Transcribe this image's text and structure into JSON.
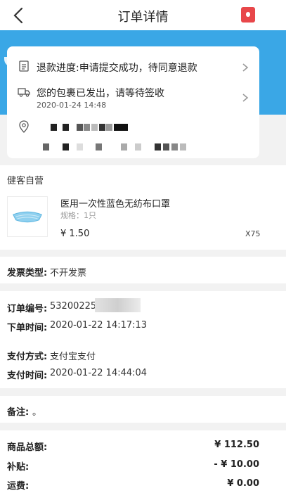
{
  "nav": {
    "title": "订单详情"
  },
  "status": {
    "refund_text": "退款进度:申请提交成功，待同意退款",
    "shipping_text": "您的包裹已发出，请等待签收",
    "shipping_time": "2020-01-24 14:48"
  },
  "shop": {
    "name": "健客自营"
  },
  "product": {
    "title": "医用一次性蓝色无纺布口罩",
    "spec": "规格：1只",
    "price": "¥ 1.50",
    "qty": "X75"
  },
  "invoice": {
    "label": "发票类型:",
    "value": "不开发票"
  },
  "order": {
    "number_label": "订单编号:",
    "number_value": "53200225",
    "time_label": "下单时间:",
    "time_value": "2020-01-22 14:17:13",
    "pay_method_label": "支付方式:",
    "pay_method_value": "支付宝支付",
    "pay_time_label": "支付时间:",
    "pay_time_value": "2020-01-22 14:44:04"
  },
  "note": {
    "label": "备注:",
    "value": "。"
  },
  "amounts": {
    "total_label": "商品总额:",
    "total_value": "¥ 112.50",
    "subsidy_label": "补贴:",
    "subsidy_value": "- ¥ 10.00",
    "shipping_label": "运费:",
    "shipping_value": "¥ 0.00"
  },
  "colors": {
    "accent_blue": "#3aa7e6",
    "badge_red": "#e8474a"
  }
}
